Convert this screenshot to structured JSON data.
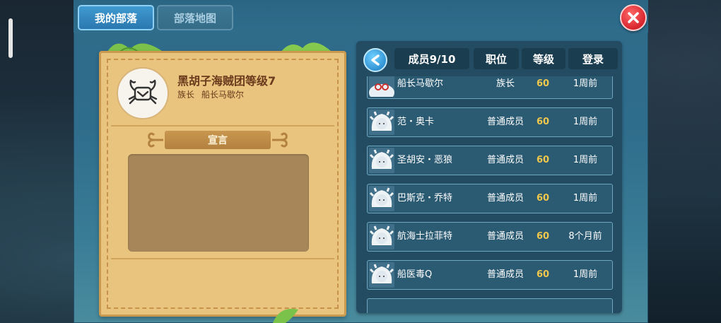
{
  "tabs": {
    "my_tribe": "我的部落",
    "tribe_map": "部落地图"
  },
  "tribe": {
    "name": "黑胡子海贼团等级7",
    "leader_title": "族长",
    "leader_name": "船长马歇尔",
    "declaration_label": "宣言",
    "declaration_text": ""
  },
  "members_header": {
    "count": "成员9/10",
    "rank": "职位",
    "level": "等级",
    "login": "登录"
  },
  "members": [
    {
      "name": "船长马歇尔",
      "rank": "族长",
      "level": "60",
      "login": "1周前"
    },
    {
      "name": "范・奥卡",
      "rank": "普通成员",
      "level": "60",
      "login": "1周前"
    },
    {
      "name": "圣胡安・恶狼",
      "rank": "普通成员",
      "level": "60",
      "login": "1周前"
    },
    {
      "name": "巴斯克・乔特",
      "rank": "普通成员",
      "level": "60",
      "login": "1周前"
    },
    {
      "name": "航海士拉菲特",
      "rank": "普通成员",
      "level": "60",
      "login": "8个月前"
    },
    {
      "name": "船医毒Q",
      "rank": "普通成员",
      "level": "60",
      "login": "1周前"
    }
  ],
  "colors": {
    "accent_blue": "#2a78b0",
    "parchment": "#e9c47e",
    "level_gold": "#f2c84a",
    "close_red": "#d7232c"
  },
  "icons": {
    "close": "close-x-icon",
    "back": "arrow-left-icon",
    "emblem": "crab-emblem-icon"
  }
}
